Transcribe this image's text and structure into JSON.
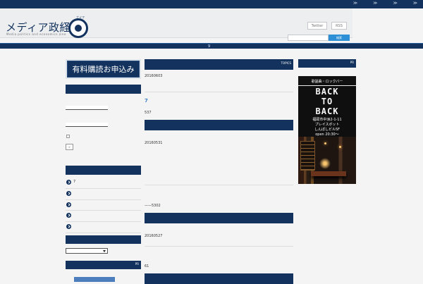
{
  "top_links": [
    "≫",
    "≫",
    "≫",
    "≫"
  ],
  "logo": {
    "title": "メディア政経",
    "ring_text": "ナイフ",
    "subtitle": "Media politics and economics zine"
  },
  "header": {
    "twitter": "Twitter",
    "rss": "RSS",
    "search_button": "検索",
    "search_placeholder": ""
  },
  "nav": {
    "item": "9"
  },
  "sidebar": {
    "subscribe": "有料購読お申込み",
    "login_check_label": "",
    "submit_label": "»",
    "list_items": [
      "7",
      "",
      "",
      "",
      ""
    ],
    "pr_label": "PR"
  },
  "main": {
    "topics_label": "TOPICS",
    "date_1": "20160603",
    "headline": "7",
    "count_1": "537",
    "date_2": "20160531",
    "text_3": "——5302",
    "date_4": "20160527",
    "count_5": "61"
  },
  "right": {
    "pr_label": "PR",
    "advert": {
      "caption": "歌謡曲・ロックバー",
      "title_lines": [
        "BACK",
        "TO",
        "BACK"
      ],
      "lines": [
        "福岡市中洲2-1-11",
        "プレイスポット",
        "しんぽしビル5F",
        "open 20:30～"
      ]
    }
  },
  "colors": {
    "navy": "#13325d",
    "accent": "#2d8fd6",
    "page_bg": "#f4f4f4"
  }
}
